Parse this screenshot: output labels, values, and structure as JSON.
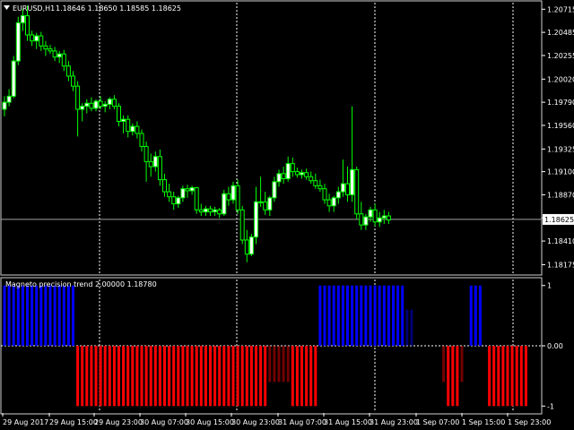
{
  "chart_data": [
    {
      "type": "candlestick",
      "title": "EURUSD,H1  1.18646 1.18650 1.18585 1.18625",
      "symbol_header": "EURUSD,H1",
      "ohlc_header": "1.18646 1.18650 1.18585 1.18625",
      "current_price": 1.18625,
      "current_price_label": "1.18625",
      "ylim": [
        1.1809,
        1.2078
      ],
      "y_ticks": [
        "1.20715",
        "1.20485",
        "1.20255",
        "1.20020",
        "1.19790",
        "1.19560",
        "1.19325",
        "1.19100",
        "1.18870",
        "1.18640",
        "1.18410",
        "1.18175"
      ],
      "y_tick_values": [
        1.20715,
        1.20485,
        1.20255,
        1.2002,
        1.1979,
        1.1956,
        1.19325,
        1.191,
        1.1887,
        1.1864,
        1.1841,
        1.18175
      ],
      "x_ticks": [
        "29 Aug 2017",
        "29 Aug 15:00",
        "29 Aug 23:00",
        "30 Aug 07:00",
        "30 Aug 15:00",
        "30 Aug 23:00",
        "31 Aug 07:00",
        "31 Aug 15:00",
        "31 Aug 23:00",
        "1 Sep 07:00",
        "1 Sep 15:00",
        "1 Sep 23:00"
      ],
      "grid": true,
      "candle_color": "#00ff00",
      "bull_body_color": "#ffffff",
      "bear_body_color": "#000000",
      "candles": [
        [
          1.1972,
          1.1985,
          1.1965,
          1.1979
        ],
        [
          1.1979,
          1.1992,
          1.1975,
          1.1985
        ],
        [
          1.1985,
          1.2025,
          1.1983,
          1.202
        ],
        [
          1.202,
          1.2064,
          1.2016,
          1.2058
        ],
        [
          1.2058,
          1.2072,
          1.205,
          1.2065
        ],
        [
          1.2065,
          1.2075,
          1.204,
          1.2046
        ],
        [
          1.2046,
          1.205,
          1.2035,
          1.204
        ],
        [
          1.204,
          1.2048,
          1.2032,
          1.2045
        ],
        [
          1.2045,
          1.2049,
          1.203,
          1.2035
        ],
        [
          1.2035,
          1.204,
          1.2025,
          1.2032
        ],
        [
          1.2032,
          1.2036,
          1.2027,
          1.203
        ],
        [
          1.203,
          1.2034,
          1.202,
          1.2024
        ],
        [
          1.2024,
          1.203,
          1.2018,
          1.2027
        ],
        [
          1.2027,
          1.2031,
          1.201,
          1.2015
        ],
        [
          1.2015,
          1.202,
          1.2,
          1.2005
        ],
        [
          1.2005,
          1.201,
          1.199,
          1.1995
        ],
        [
          1.1995,
          1.2,
          1.1945,
          1.1972
        ],
        [
          1.1972,
          1.1978,
          1.196,
          1.1975
        ],
        [
          1.1975,
          1.1982,
          1.1968,
          1.1978
        ],
        [
          1.1978,
          1.1984,
          1.197,
          1.1973
        ],
        [
          1.1973,
          1.1982,
          1.197,
          1.198
        ],
        [
          1.198,
          1.1985,
          1.1972,
          1.1975
        ],
        [
          1.1975,
          1.198,
          1.1969,
          1.1977
        ],
        [
          1.1977,
          1.1984,
          1.1972,
          1.1982
        ],
        [
          1.1982,
          1.1986,
          1.1972,
          1.1975
        ],
        [
          1.1975,
          1.1978,
          1.1955,
          1.196
        ],
        [
          1.196,
          1.1966,
          1.1948,
          1.1962
        ],
        [
          1.1962,
          1.1966,
          1.1944,
          1.195
        ],
        [
          1.195,
          1.1958,
          1.1946,
          1.1955
        ],
        [
          1.1955,
          1.196,
          1.1943,
          1.1948
        ],
        [
          1.1948,
          1.1952,
          1.193,
          1.1935
        ],
        [
          1.1935,
          1.194,
          1.19,
          1.192
        ],
        [
          1.192,
          1.1928,
          1.1905,
          1.1915
        ],
        [
          1.1915,
          1.193,
          1.191,
          1.1925
        ],
        [
          1.1925,
          1.1932,
          1.1896,
          1.1902
        ],
        [
          1.1902,
          1.1908,
          1.1885,
          1.189
        ],
        [
          1.189,
          1.1898,
          1.188,
          1.1885
        ],
        [
          1.1885,
          1.189,
          1.1872,
          1.1878
        ],
        [
          1.1878,
          1.1886,
          1.1874,
          1.1884
        ],
        [
          1.1884,
          1.1896,
          1.188,
          1.1893
        ],
        [
          1.1893,
          1.1897,
          1.1884,
          1.1891
        ],
        [
          1.1891,
          1.1896,
          1.1887,
          1.1894
        ],
        [
          1.1894,
          1.1895,
          1.1868,
          1.1872
        ],
        [
          1.1872,
          1.1878,
          1.1866,
          1.187
        ],
        [
          1.187,
          1.1876,
          1.1866,
          1.1873
        ],
        [
          1.1873,
          1.1876,
          1.1866,
          1.187
        ],
        [
          1.187,
          1.1875,
          1.1866,
          1.1872
        ],
        [
          1.1872,
          1.1874,
          1.1864,
          1.1868
        ],
        [
          1.1868,
          1.1892,
          1.1866,
          1.1888
        ],
        [
          1.1888,
          1.1895,
          1.1876,
          1.1882
        ],
        [
          1.1882,
          1.19,
          1.1878,
          1.1896
        ],
        [
          1.1896,
          1.1902,
          1.1868,
          1.1872
        ],
        [
          1.1872,
          1.1876,
          1.1838,
          1.1842
        ],
        [
          1.1842,
          1.1852,
          1.182,
          1.1828
        ],
        [
          1.1828,
          1.1848,
          1.1826,
          1.1845
        ],
        [
          1.1845,
          1.1895,
          1.1838,
          1.188
        ],
        [
          1.188,
          1.1905,
          1.1875,
          1.188
        ],
        [
          1.188,
          1.189,
          1.1867,
          1.1872
        ],
        [
          1.1872,
          1.1886,
          1.1866,
          1.1884
        ],
        [
          1.1884,
          1.1905,
          1.188,
          1.19
        ],
        [
          1.19,
          1.1912,
          1.1895,
          1.1908
        ],
        [
          1.1908,
          1.1915,
          1.1898,
          1.1903
        ],
        [
          1.1903,
          1.1925,
          1.19,
          1.1918
        ],
        [
          1.1918,
          1.1924,
          1.1905,
          1.191
        ],
        [
          1.191,
          1.1914,
          1.1904,
          1.1907
        ],
        [
          1.1907,
          1.1912,
          1.1903,
          1.1909
        ],
        [
          1.1909,
          1.1913,
          1.1902,
          1.1905
        ],
        [
          1.1905,
          1.191,
          1.1898,
          1.1901
        ],
        [
          1.1901,
          1.1908,
          1.1893,
          1.1896
        ],
        [
          1.1896,
          1.1902,
          1.189,
          1.1893
        ],
        [
          1.1893,
          1.1898,
          1.1878,
          1.1882
        ],
        [
          1.1882,
          1.1888,
          1.187,
          1.1876
        ],
        [
          1.1876,
          1.1886,
          1.187,
          1.1884
        ],
        [
          1.1884,
          1.1895,
          1.1878,
          1.189
        ],
        [
          1.189,
          1.1922,
          1.1885,
          1.1898
        ],
        [
          1.1898,
          1.1915,
          1.188,
          1.1887
        ],
        [
          1.1887,
          1.1975,
          1.188,
          1.1912
        ],
        [
          1.1912,
          1.1915,
          1.1863,
          1.1868
        ],
        [
          1.1868,
          1.188,
          1.1852,
          1.1857
        ],
        [
          1.1857,
          1.1868,
          1.1852,
          1.1865
        ],
        [
          1.1865,
          1.1875,
          1.186,
          1.1872
        ],
        [
          1.1872,
          1.1878,
          1.1856,
          1.186
        ],
        [
          1.186,
          1.187,
          1.1855,
          1.1864
        ],
        [
          1.1864,
          1.1872,
          1.1858,
          1.1866
        ],
        [
          1.1866,
          1.187,
          1.1858,
          1.1862
        ]
      ]
    },
    {
      "type": "bar",
      "title": "Magneto precision trend 2.00000 1.18780",
      "ylim": [
        -1.1,
        1.1
      ],
      "y_ticks": [
        "1",
        "0.00",
        "-1"
      ],
      "y_tick_values": [
        1,
        0,
        -1
      ],
      "positive_color": "#0000ff",
      "negative_color": "#ff0000",
      "values": [
        1,
        1,
        1,
        1,
        1,
        1,
        1,
        1,
        1,
        1,
        1,
        1,
        1,
        1,
        1,
        1,
        -1,
        -1,
        -1,
        -1,
        -1,
        -1,
        -1,
        -1,
        -1,
        -1,
        -1,
        -1,
        -1,
        -1,
        -1,
        -1,
        -1,
        -1,
        -1,
        -1,
        -1,
        -1,
        -1,
        -1,
        -1,
        -1,
        -1,
        -1,
        -1,
        -1,
        -1,
        -1,
        -1,
        -1,
        -1,
        -1,
        -1,
        -1,
        -1,
        -1,
        -1,
        -1,
        -0.6,
        -0.6,
        -0.6,
        -0.6,
        -0.6,
        -1,
        -1,
        -1,
        -1,
        -1,
        -1,
        1,
        1,
        1,
        1,
        1,
        1,
        1,
        1,
        1,
        1,
        1,
        1,
        1,
        1,
        1,
        1,
        1,
        1,
        1,
        0.6,
        0.6,
        0,
        0,
        0,
        0,
        0,
        0,
        -0.6,
        -1,
        -1,
        -1,
        -0.6,
        0,
        1,
        1,
        1,
        0,
        -1,
        -1,
        -1,
        -1,
        -1,
        -1,
        -1,
        -1,
        -1
      ]
    }
  ]
}
